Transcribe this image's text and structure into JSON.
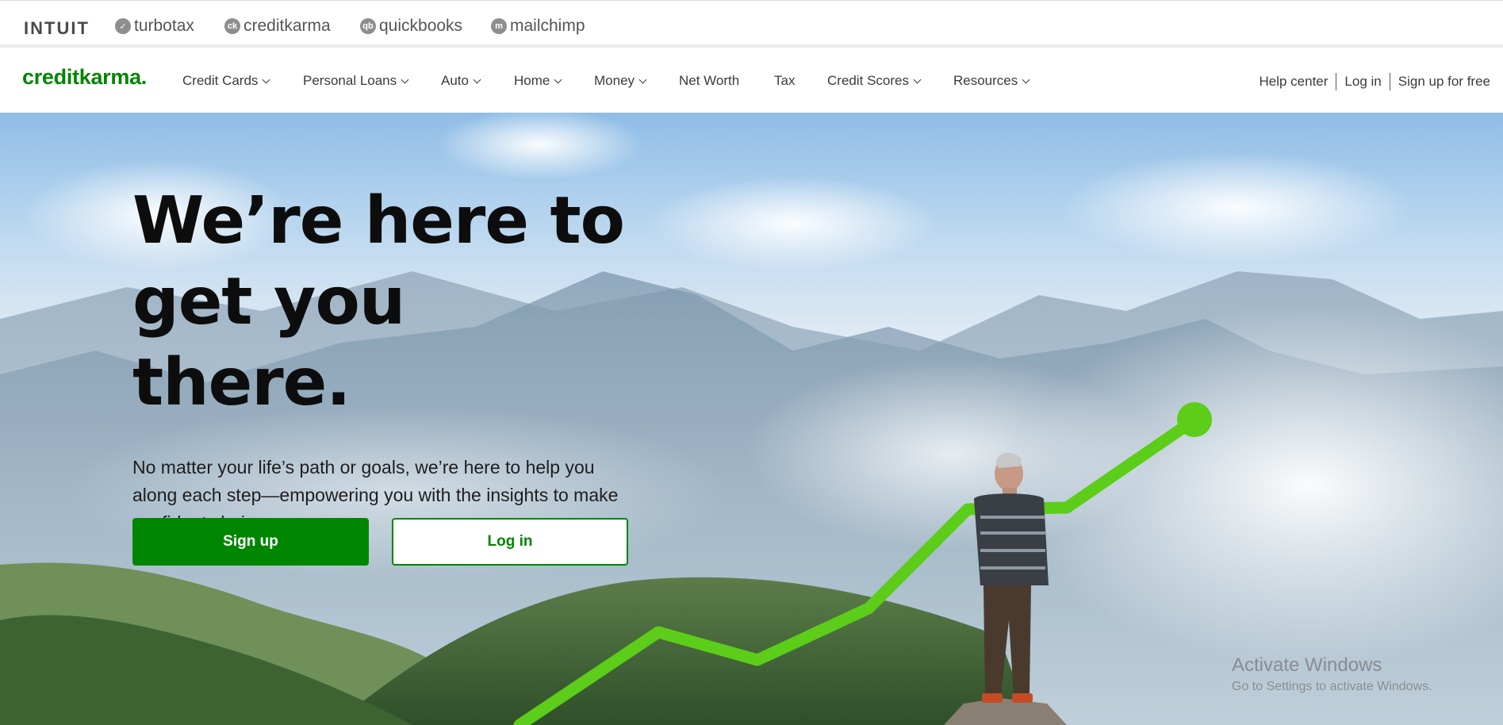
{
  "brandbar": {
    "intuit": "INTUIT",
    "brands": [
      {
        "label": "turbotax",
        "icon": "check-icon",
        "glyph": "✓"
      },
      {
        "label": "creditkarma",
        "icon": "ck-icon",
        "glyph": "ck"
      },
      {
        "label": "quickbooks",
        "icon": "qb-icon",
        "glyph": "qb"
      },
      {
        "label": "mailchimp",
        "icon": "chimp-icon",
        "glyph": "m"
      }
    ]
  },
  "nav": {
    "logo": "creditkarma.",
    "items": [
      {
        "label": "Credit Cards",
        "dropdown": true
      },
      {
        "label": "Personal Loans",
        "dropdown": true
      },
      {
        "label": "Auto",
        "dropdown": true
      },
      {
        "label": "Home",
        "dropdown": true
      },
      {
        "label": "Money",
        "dropdown": true
      },
      {
        "label": "Net Worth",
        "dropdown": false
      },
      {
        "label": "Tax",
        "dropdown": false
      },
      {
        "label": "Credit Scores",
        "dropdown": true
      },
      {
        "label": "Resources",
        "dropdown": true
      }
    ],
    "util": {
      "help": "Help center",
      "login": "Log in",
      "signup": "Sign up for free"
    }
  },
  "hero": {
    "title_line1": "We’re here to",
    "title_line2": "get you there.",
    "body": "No matter your life’s path or goals, we’re here to help you along each step—empowering you with the insights to make confident choices.",
    "signup_label": "Sign up",
    "login_label": "Log in"
  },
  "watermark": {
    "line1": "Activate Windows",
    "line2": "Go to Settings to activate Windows."
  },
  "colors": {
    "brand_green": "#008600",
    "graph_green": "#5ccd18"
  }
}
